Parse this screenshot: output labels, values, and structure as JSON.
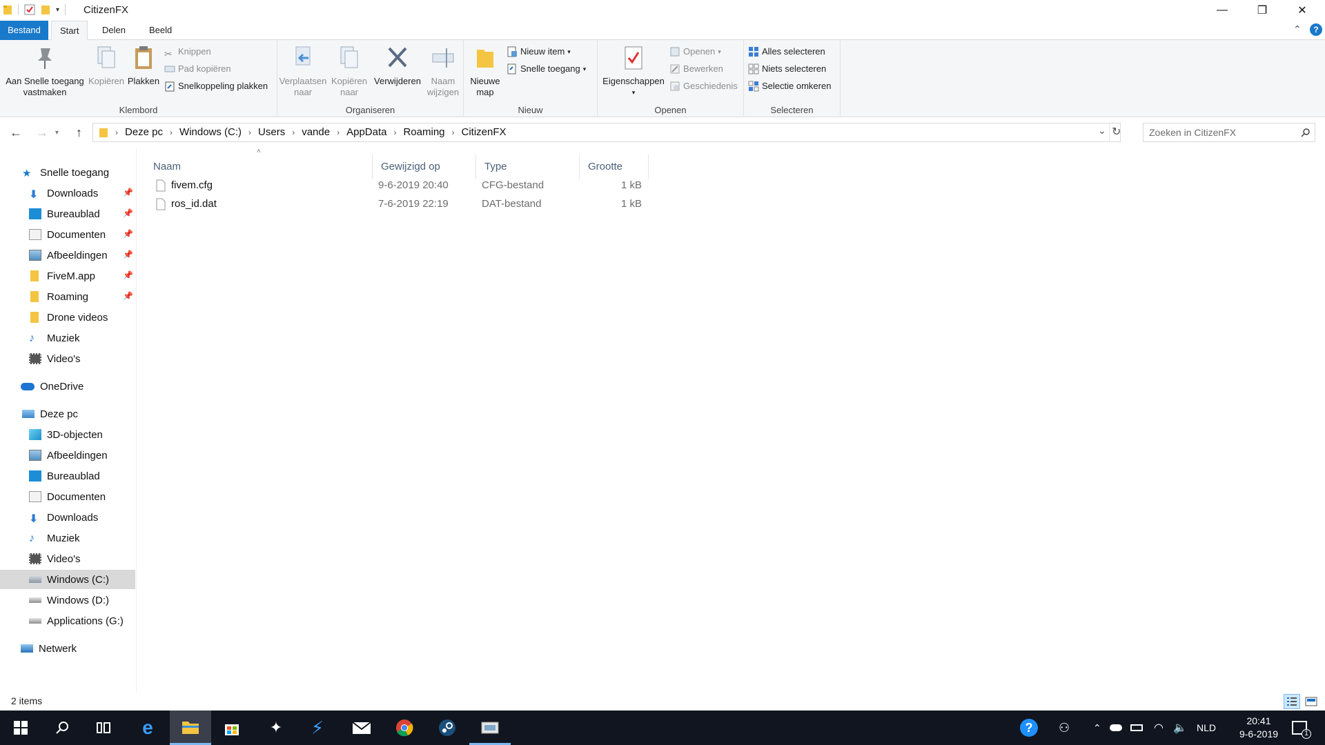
{
  "window": {
    "title": "CitizenFX",
    "controls": {
      "minimize": "—",
      "restore": "❐",
      "close": "✕"
    }
  },
  "tabs": [
    {
      "label": "Bestand"
    },
    {
      "label": "Start"
    },
    {
      "label": "Delen"
    },
    {
      "label": "Beeld"
    }
  ],
  "ribbon": {
    "klembord": {
      "label": "Klembord",
      "pin_line1": "Aan Snelle toegang",
      "pin_line2": "vastmaken",
      "copy": "Kopiëren",
      "paste": "Plakken",
      "cut": "Knippen",
      "copy_path": "Pad kopiëren",
      "paste_shortcut": "Snelkoppeling plakken"
    },
    "organiseren": {
      "label": "Organiseren",
      "move_line1": "Verplaatsen",
      "move_line2": "naar",
      "copyto_line1": "Kopiëren",
      "copyto_line2": "naar",
      "delete": "Verwijderen",
      "rename_line1": "Naam",
      "rename_line2": "wijzigen"
    },
    "nieuw": {
      "label": "Nieuw",
      "new_folder_line1": "Nieuwe",
      "new_folder_line2": "map",
      "new_item": "Nieuw item",
      "easy_access": "Snelle toegang"
    },
    "openen": {
      "label": "Openen",
      "properties": "Eigenschappen",
      "open": "Openen",
      "edit": "Bewerken",
      "history": "Geschiedenis"
    },
    "selecteren": {
      "label": "Selecteren",
      "select_all": "Alles selecteren",
      "select_none": "Niets selecteren",
      "invert": "Selectie omkeren"
    }
  },
  "address": {
    "crumbs": [
      "Deze pc",
      "Windows (C:)",
      "Users",
      "vande",
      "AppData",
      "Roaming",
      "CitizenFX"
    ],
    "search_placeholder": "Zoeken in CitizenFX"
  },
  "navpane": {
    "quick_access": "Snelle toegang",
    "quick_items": [
      "Downloads",
      "Bureaublad",
      "Documenten",
      "Afbeeldingen",
      "FiveM.app",
      "Roaming",
      "Drone videos",
      "Muziek",
      "Video's"
    ],
    "onedrive": "OneDrive",
    "this_pc": "Deze pc",
    "pc_items": [
      "3D-objecten",
      "Afbeeldingen",
      "Bureaublad",
      "Documenten",
      "Downloads",
      "Muziek",
      "Video's",
      "Windows (C:)",
      "Windows (D:)",
      "Applications (G:)"
    ],
    "network": "Netwerk"
  },
  "filelist": {
    "columns": {
      "name": "Naam",
      "date": "Gewijzigd op",
      "type": "Type",
      "size": "Grootte"
    },
    "rows": [
      {
        "name": "fivem.cfg",
        "date": "9-6-2019 20:40",
        "type": "CFG-bestand",
        "size": "1 kB"
      },
      {
        "name": "ros_id.dat",
        "date": "7-6-2019 22:19",
        "type": "DAT-bestand",
        "size": "1 kB"
      }
    ]
  },
  "status": {
    "count": "2 items"
  },
  "taskbar": {
    "language": "NLD",
    "time": "20:41",
    "date": "9-6-2019",
    "notification_count": "1"
  }
}
